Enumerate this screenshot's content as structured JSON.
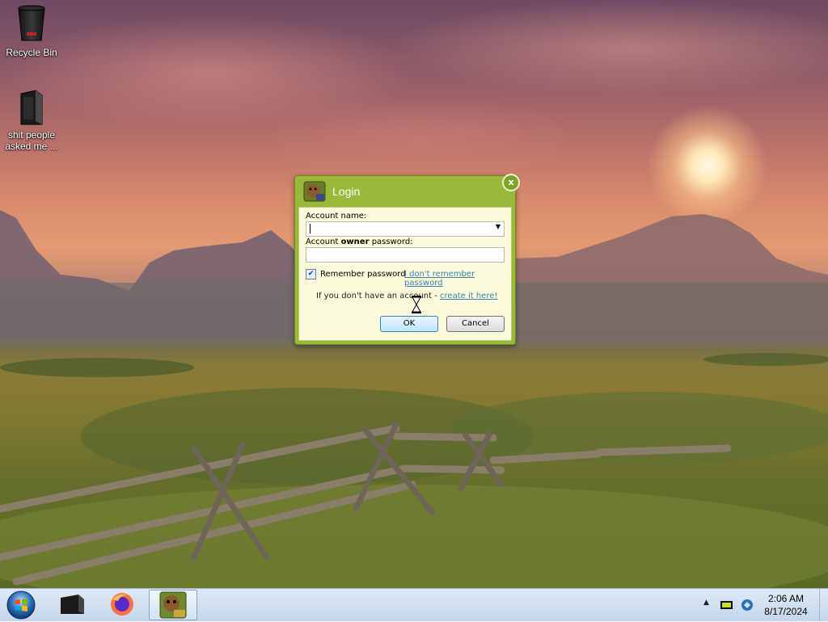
{
  "desktop": {
    "icons": [
      {
        "label": "Recycle Bin"
      },
      {
        "label": "shit people asked me ..."
      }
    ]
  },
  "dialog": {
    "title": "Login",
    "close_glyph": "x",
    "account_label": "Account name:",
    "password_label_prefix": "Account ",
    "password_label_bold": "owner",
    "password_label_suffix": " password:",
    "account_value": "",
    "password_value": "",
    "remember_label": "Remember password",
    "remember_checked": true,
    "forgot_link": "I don't remember password",
    "no_account_text": "If you don't have an account - ",
    "create_link": "create it here!",
    "ok_label": "OK",
    "cancel_label": "Cancel"
  },
  "taskbar": {
    "items": [
      "start-orb",
      "server-app-icon",
      "firefox-icon",
      "box-app-icon"
    ],
    "clock_time": "2:06 AM",
    "clock_date": "8/17/2024"
  },
  "colors": {
    "dialog_frame": "#9ab83a",
    "dialog_body": "#fbfbdc",
    "link": "#3a7fae"
  }
}
